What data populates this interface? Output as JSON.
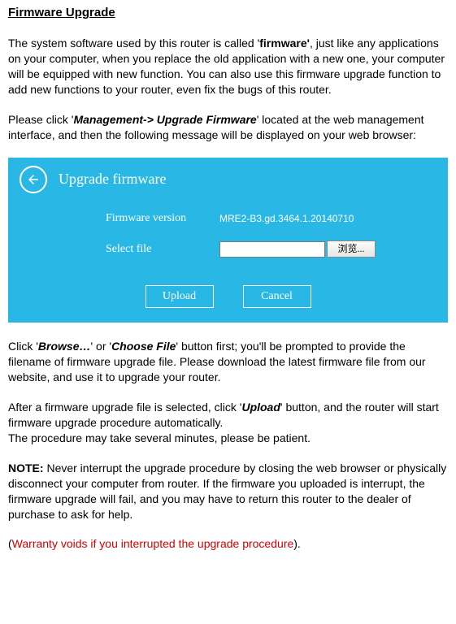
{
  "title": "Firmware Upgrade",
  "p1": {
    "a": "The system software used by this router is called '",
    "bold": "firmware'",
    "b": ", just like any applications on your computer, when you replace the old application with a new one, your computer will be equipped with new function. You can also use this firmware upgrade function to add new functions to your router, even fix the bugs of this router."
  },
  "p2": {
    "a": "Please click '",
    "bi": "Management-> Upgrade Firmware",
    "b": "' located at the web management interface, and then the following message will be displayed on your web browser:"
  },
  "ui": {
    "title": "Upgrade firmware",
    "labels": {
      "version": "Firmware version",
      "select": "Select file"
    },
    "version_value": "MRE2-B3.gd.3464.1.20140710",
    "browse_label": "浏览...",
    "upload": "Upload",
    "cancel": "Cancel"
  },
  "p3": {
    "a": "Click '",
    "bi1": "Browse…",
    "b": "' or '",
    "bi2": "Choose File",
    "c": "' button first; you'll be prompted to provide the filename of firmware upgrade file. Please download the latest firmware file from our website, and use it to upgrade your router."
  },
  "p4": {
    "a": "After a firmware upgrade file is selected, click '",
    "bi": "Upload",
    "b": "' button, and the router will start firmware upgrade procedure automatically."
  },
  "p4b": "The procedure may take several minutes, please be patient.",
  "p5": {
    "bold": "NOTE:",
    "rest": " Never interrupt the upgrade procedure by closing the web browser or physically disconnect your computer from router. If the firmware you uploaded is interrupt, the firmware upgrade will fail, and you may have to return this router to the dealer of purchase to ask for help."
  },
  "p6": {
    "a": "(",
    "red": "Warranty voids if you interrupted the upgrade procedure",
    "b": ")."
  }
}
